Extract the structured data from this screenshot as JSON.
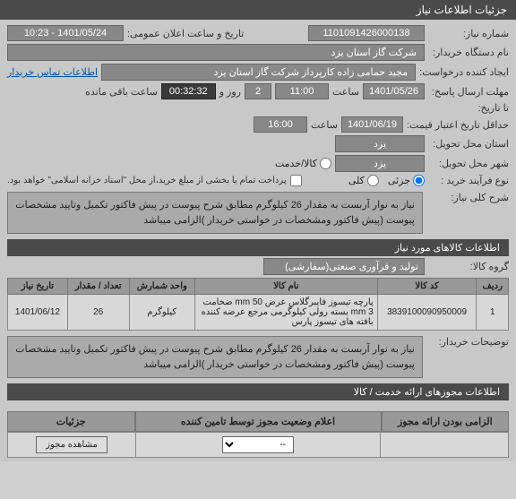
{
  "header": {
    "title": "جزئیات اطلاعات نیاز"
  },
  "form": {
    "need_no_label": "شماره نیاز:",
    "need_no": "1101091426000138",
    "announce_label": "تاریخ و ساعت اعلان عمومی:",
    "announce_value": "1401/05/24 - 10:23",
    "buyer_label": "نام دستگاه خریدار:",
    "buyer_value": "شرکت گاز استان یزد",
    "requester_label": "ایجاد کننده درخواست:",
    "requester_value": "مجید حمامی زاده کارپرداز شرکت گاز استان یزد",
    "contact_link": "اطلاعات تماس خریدار",
    "send_deadline_label": "مهلت ارسال پاسخ:",
    "send_deadline_date": "1401/05/26",
    "time_label": "ساعت",
    "send_deadline_time": "11:00",
    "day_label": "روز و",
    "day_value": "2",
    "remain_label": "ساعت باقی مانده",
    "remain_time": "00:32:32",
    "until_label": "تا تاریخ:",
    "validity_label": "حداقل تاریخ اعتبار قیمت:",
    "validity_date": "1401/06/19",
    "validity_time": "16:00",
    "province_label": "استان محل تحویل:",
    "province_value": "یزد",
    "city_label": "شهر محل تحویل:",
    "city_value": "یزد",
    "process_label": "نوع فرآیند خرید :",
    "radio_goods": "کالا/خدمت",
    "radio_partial": "جزئی",
    "radio_full": "کلی",
    "payment_note": "پرداخت تمام یا بخشی از مبلغ خرید،از محل \"اسناد خزانه اسلامی\" خواهد بود.",
    "summary_label": "شرح کلی نیاز:",
    "summary_text": "نیاز به نوار آربست  به مقدار 26 کیلوگرم مطابق شرح پیوست در پیش فاکتور تکمیل وتایید مشخصات پیوست (پیش فاکتور ومشخصات در خواستی خریدار )الزامی میباشد"
  },
  "items_header": "اطلاعات کالاهای مورد نیاز",
  "group_label": "گروه کالا:",
  "group_value": "تولید و فرآوری صنعتی(سفارشی)",
  "table": {
    "cols": {
      "row": "ردیف",
      "code": "کد کالا",
      "name": "نام کالا",
      "unit": "واحد شمارش",
      "qty": "تعداد / مقدار",
      "date": "تاریخ نیاز"
    },
    "rows": [
      {
        "row": "1",
        "code": "3839100090950009",
        "name": "پارچه تیسوز فایبرگلاس عرض 50 mm ضخامت 3 mm بسته رولی کیلوگرمی مرجع عرضه کننده بافته های تیسوز پارس",
        "unit": "کیلوگرم",
        "qty": "26",
        "date": "1401/06/12"
      }
    ]
  },
  "buyer_notes_label": "توضیحات خریدار:",
  "buyer_notes_text": "نیاز به نوار آربست  به مقدار 26 کیلوگرم مطابق شرح پیوست در پیش فاکتور تکمیل وتایید مشخصات پیوست (پیش فاکتور ومشخصات در خواستی خریدار )الزامی میباشد",
  "permits_header": "اطلاعات مجوزهای ارائه خدمت / کالا",
  "status": {
    "col1": "الزامی بودن ارائه مجوز",
    "col2": "اعلام وضعیت مجوز توسط تامین کننده",
    "col3": "جزئیات",
    "select_placeholder": "--",
    "view_btn": "مشاهده مجوز"
  }
}
